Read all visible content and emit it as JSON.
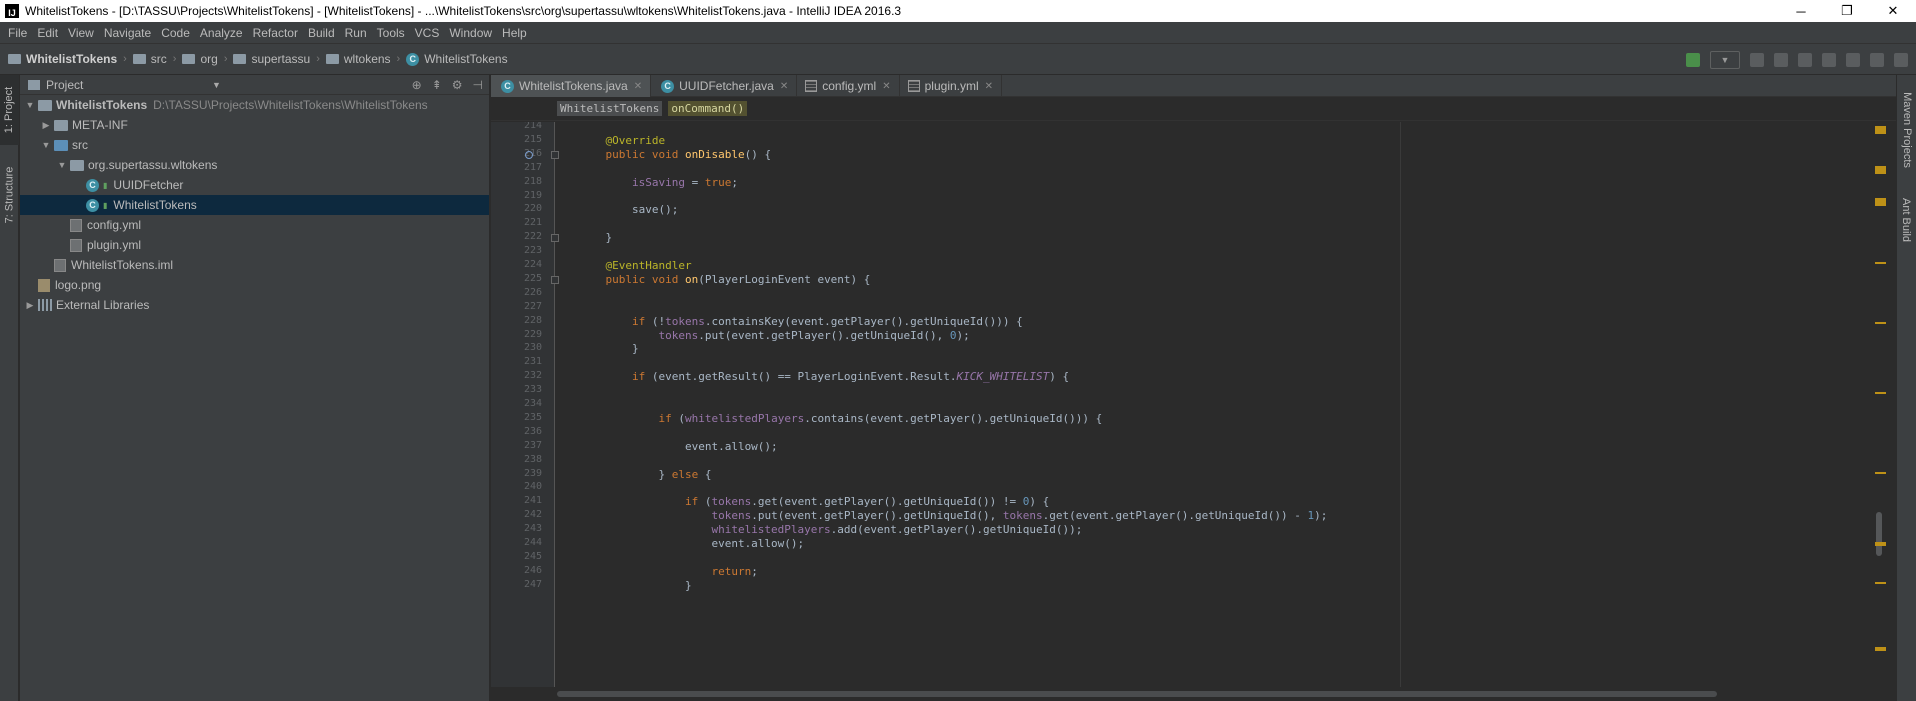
{
  "window": {
    "title": "WhitelistTokens - [D:\\TASSU\\Projects\\WhitelistTokens] - [WhitelistTokens] - ...\\WhitelistTokens\\src\\org\\supertassu\\wltokens\\WhitelistTokens.java - IntelliJ IDEA 2016.3",
    "controls": {
      "minimize": "─",
      "maximize": "❐",
      "close": "✕"
    }
  },
  "menu": [
    "File",
    "Edit",
    "View",
    "Navigate",
    "Code",
    "Analyze",
    "Refactor",
    "Build",
    "Run",
    "Tools",
    "VCS",
    "Window",
    "Help"
  ],
  "breadcrumbs": [
    {
      "label": "WhitelistTokens",
      "icon": "project-folder-icon"
    },
    {
      "label": "src",
      "icon": "folder-icon"
    },
    {
      "label": "org",
      "icon": "folder-icon"
    },
    {
      "label": "supertassu",
      "icon": "folder-icon"
    },
    {
      "label": "wltokens",
      "icon": "folder-icon"
    },
    {
      "label": "WhitelistTokens",
      "icon": "class-icon"
    }
  ],
  "left_strip": {
    "project_tab": "1: Project",
    "structure_tab": "7: Structure"
  },
  "right_strip": {
    "maven_tab": "Maven Projects",
    "ant_tab": "Ant Build"
  },
  "project_panel": {
    "header": "Project",
    "tree": [
      {
        "depth": 0,
        "arrow": "▼",
        "icon": "module",
        "label": "WhitelistTokens",
        "path": "D:\\TASSU\\Projects\\WhitelistTokens\\WhitelistTokens",
        "bold": true
      },
      {
        "depth": 1,
        "arrow": "▶",
        "icon": "folder",
        "label": "META-INF"
      },
      {
        "depth": 1,
        "arrow": "▼",
        "icon": "folder-blue",
        "label": "src"
      },
      {
        "depth": 2,
        "arrow": "▼",
        "icon": "folder",
        "label": "org.supertassu.wltokens"
      },
      {
        "depth": 3,
        "arrow": "",
        "icon": "class",
        "label": "UUIDFetcher"
      },
      {
        "depth": 3,
        "arrow": "",
        "icon": "class",
        "label": "WhitelistTokens",
        "selected": true
      },
      {
        "depth": 2,
        "arrow": "",
        "icon": "file",
        "label": "config.yml"
      },
      {
        "depth": 2,
        "arrow": "",
        "icon": "file",
        "label": "plugin.yml"
      },
      {
        "depth": 1,
        "arrow": "",
        "icon": "file",
        "label": "WhitelistTokens.iml"
      },
      {
        "depth": 0,
        "arrow": "",
        "icon": "image",
        "label": "logo.png"
      },
      {
        "depth": 0,
        "arrow": "▶",
        "icon": "library",
        "label": "External Libraries"
      }
    ]
  },
  "editor": {
    "tabs": [
      {
        "label": "WhitelistTokens.java",
        "icon": "class",
        "active": true
      },
      {
        "label": "UUIDFetcher.java",
        "icon": "class"
      },
      {
        "label": "config.yml",
        "icon": "yml"
      },
      {
        "label": "plugin.yml",
        "icon": "yml"
      }
    ],
    "code_breadcrumbs": [
      "WhitelistTokens",
      "onCommand()"
    ],
    "first_line": 214,
    "lines": [
      "",
      "    <span class='an'>@Override</span>",
      "    <span class='kw'>public void </span><span class='fn'>onDisable</span>() {",
      "",
      "        <span class='fd'>isSaving</span> = <span class='kw'>true</span>;",
      "",
      "        save();",
      "",
      "    }",
      "",
      "    <span class='an'>@EventHandler</span>",
      "    <span class='kw'>public void </span><span class='fn'>on</span>(PlayerLoginEvent event) {",
      "",
      "",
      "        <span class='kw'>if </span>(!<span class='fd'>tokens</span>.containsKey(event.getPlayer().getUniqueId())) {",
      "            <span class='fd'>tokens</span>.put(event.getPlayer().getUniqueId(), <span class='nm'>0</span>);",
      "        }",
      "",
      "        <span class='kw'>if </span>(event.getResult() == PlayerLoginEvent.Result.<span class='it'>KICK_WHITELIST</span>) {",
      "",
      "",
      "            <span class='kw'>if </span>(<span class='fd'>whitelistedPlayers</span>.contains(event.getPlayer().getUniqueId())) {",
      "",
      "                event.allow();",
      "",
      "            } <span class='kw'>else </span>{",
      "",
      "                <span class='kw'>if </span>(<span class='fd'>tokens</span>.get(event.getPlayer().getUniqueId()) != <span class='nm'>0</span>) {",
      "                    <span class='fd'>tokens</span>.put(event.getPlayer().getUniqueId(), <span class='fd'>tokens</span>.get(event.getPlayer().getUniqueId()) - <span class='nm'>1</span>);",
      "                    <span class='fd'>whitelistedPlayers</span>.add(event.getPlayer().getUniqueId());",
      "                    event.allow();",
      "",
      "                    <span class='kw'>return</span>;",
      "                }"
    ]
  },
  "colors": {
    "background": "#2b2b2b",
    "panel": "#3c3f41",
    "selection": "#0d293e",
    "keyword": "#cc7832",
    "annotation": "#bbb529",
    "field": "#9876aa",
    "method": "#ffc66d",
    "number": "#6897bb"
  }
}
